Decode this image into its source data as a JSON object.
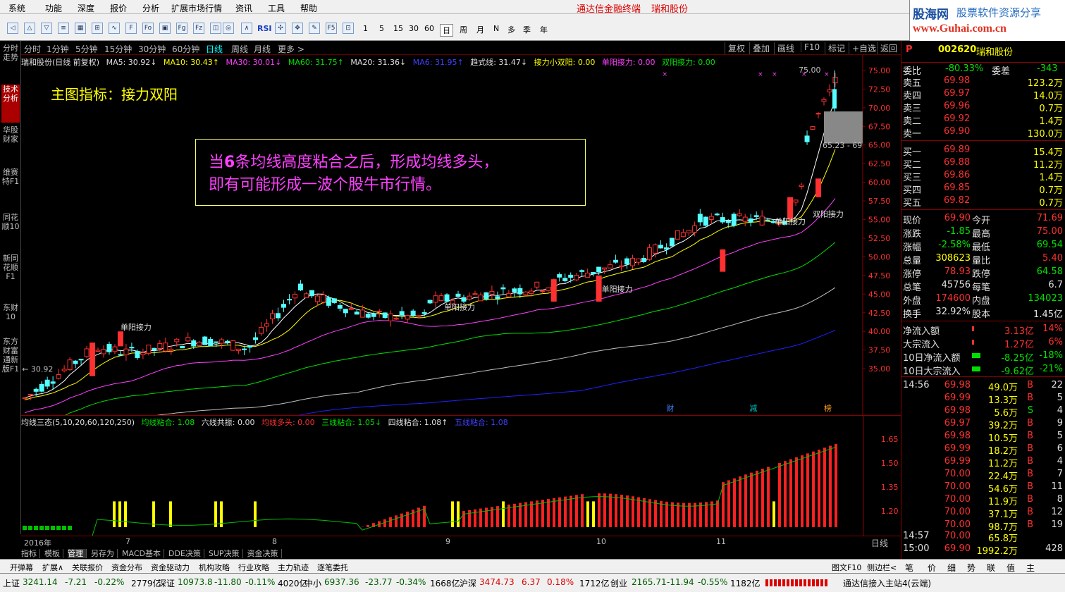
{
  "menu": {
    "items": [
      "系统",
      "功能",
      "深度",
      "报价",
      "分析",
      "扩展市场行情",
      "资讯",
      "工具",
      "帮助"
    ],
    "center_title": "通达信金融终端",
    "stock_title": "瑞和股份"
  },
  "logo": {
    "line1": "股海网",
    "line1b": "股票软件资源分享",
    "line2": "www.Guhai.com.cn"
  },
  "toolbar": {
    "num_buttons": [
      "1",
      "5",
      "15",
      "30",
      "60"
    ],
    "period_buttons": [
      "日",
      "周",
      "月",
      "N",
      "多",
      "季",
      "年"
    ]
  },
  "leftbar": {
    "tabs": [
      "分时走势",
      "技术分析",
      "华股财家",
      "维赛特F1",
      "同花顺10",
      "新同花顺F1",
      "东财10",
      "东方财富通新版F1"
    ]
  },
  "periods": {
    "items": [
      "分时",
      "1分钟",
      "5分钟",
      "15分钟",
      "30分钟",
      "60分钟",
      "日线",
      "周线",
      "月线",
      "更多 >"
    ],
    "right": [
      "复权",
      "叠加",
      "画线",
      "F10",
      "标记",
      "+自选",
      "返回"
    ]
  },
  "legend": {
    "name": "瑞和股份(日线 前复权)",
    "ma5": "MA5: 30.92↓",
    "ma10": "MA10: 30.43↑",
    "ma30": "MA30: 30.01↓",
    "ma60": "MA60: 31.75↑",
    "ma20": "MA20: 31.36↓",
    "ma6": "MA6: 31.95↑",
    "trend": "趋式线: 31.47↓",
    "relay": "接力小双阳: 0.00",
    "single": "单阳接力: 0.00",
    "double": "双阳接力: 0.00"
  },
  "annotation": {
    "title": "主图指标：接力双阳",
    "callout_1a": "当",
    "callout_1b": "6",
    "callout_1c": "条均线高度粘合之后，形成均线多头，",
    "callout_2": "即有可能形成一波个股牛市行情。"
  },
  "price_axis": {
    "labels": [
      "75.00",
      "72.50",
      "70.00",
      "67.50",
      "65.00",
      "62.50",
      "60.00",
      "57.50",
      "55.00",
      "52.50",
      "50.00",
      "47.50",
      "45.00",
      "42.50",
      "40.00",
      "37.50",
      "35.00"
    ]
  },
  "chart_marks": {
    "high": "75.00",
    "range": "65.23 - 69",
    "low": "30.92",
    "labels": [
      "单阳接力",
      "单阳接力",
      "单阳接力",
      "单阳接力",
      "双阳接力"
    ],
    "events": [
      "财",
      "减",
      "榜"
    ]
  },
  "sub_legend": {
    "title": "均线三态(5,10,20,60,120,250)",
    "a": "均线粘合: 1.08",
    "b": "六线共振: 0.00",
    "c": "均线多头: 0.00",
    "d": "三线粘合: 1.05↓",
    "e": "四线粘合: 1.08↑",
    "f": "五线粘合: 1.08"
  },
  "sub_axis": {
    "labels": [
      "1.65",
      "1.50",
      "1.35",
      "1.20"
    ]
  },
  "xaxis": {
    "labels": [
      "2016年",
      "7",
      "8",
      "9",
      "10",
      "11"
    ],
    "right": "日线"
  },
  "bottom_tabs": [
    "指标",
    "模板",
    "管理",
    "另存为",
    "MACD基本",
    "DDE决策",
    "SUP决策",
    "资金决策"
  ],
  "funcbar": [
    "开弹幕",
    "扩展∧",
    "关联报价",
    "资金分布",
    "资金驱动力",
    "机构攻略",
    "行业攻略",
    "主力轨迹",
    "逐笔委托"
  ],
  "funcbar_right": [
    "图文F10",
    "侧边栏<"
  ],
  "quote": {
    "code": "002620",
    "name": "瑞和股份",
    "p": "P",
    "wb_label": "委比",
    "wb": "-80.33%",
    "wc_label": "委差",
    "wc": "-343",
    "asks": [
      [
        "卖五",
        "69.98",
        "123.2万"
      ],
      [
        "卖四",
        "69.97",
        "14.0万"
      ],
      [
        "卖三",
        "69.96",
        "0.7万"
      ],
      [
        "卖二",
        "69.92",
        "1.4万"
      ],
      [
        "卖一",
        "69.90",
        "130.0万"
      ]
    ],
    "bids": [
      [
        "买一",
        "69.89",
        "15.4万"
      ],
      [
        "买二",
        "69.88",
        "11.2万"
      ],
      [
        "买三",
        "69.86",
        "1.4万"
      ],
      [
        "买四",
        "69.85",
        "0.7万"
      ],
      [
        "买五",
        "69.82",
        "0.7万"
      ]
    ],
    "stats": [
      [
        "现价",
        "69.90",
        "今开",
        "71.69"
      ],
      [
        "涨跌",
        "-1.85",
        "最高",
        "75.00"
      ],
      [
        "涨幅",
        "-2.58%",
        "最低",
        "69.54"
      ],
      [
        "总量",
        "308623",
        "量比",
        "5.40"
      ],
      [
        "涨停",
        "78.93",
        "跌停",
        "64.58"
      ],
      [
        "总笔",
        "45756",
        "每笔",
        "6.7"
      ],
      [
        "外盘",
        "174600",
        "内盘",
        "134023"
      ],
      [
        "换手",
        "32.92%",
        "股本",
        "1.45亿"
      ]
    ],
    "flows": [
      [
        "净流入额",
        "3.13亿",
        "14%"
      ],
      [
        "大宗流入",
        "1.27亿",
        "6%"
      ],
      [
        "10日净流入额",
        "-8.25亿",
        "-18%"
      ],
      [
        "10日大宗流入",
        "-9.62亿",
        "-21%"
      ]
    ],
    "ticks": [
      [
        "14:56",
        "69.98",
        "49.0万",
        "B",
        "22"
      ],
      [
        "",
        "69.99",
        "13.3万",
        "B",
        "5"
      ],
      [
        "",
        "69.98",
        "5.6万",
        "S",
        "4"
      ],
      [
        "",
        "69.97",
        "39.2万",
        "B",
        "9"
      ],
      [
        "",
        "69.98",
        "10.5万",
        "B",
        "5"
      ],
      [
        "",
        "69.99",
        "18.2万",
        "B",
        "6"
      ],
      [
        "",
        "69.99",
        "11.2万",
        "B",
        "4"
      ],
      [
        "",
        "70.00",
        "22.4万",
        "B",
        "7"
      ],
      [
        "",
        "70.00",
        "54.6万",
        "B",
        "11"
      ],
      [
        "",
        "70.00",
        "11.9万",
        "B",
        "8"
      ],
      [
        "",
        "70.00",
        "37.1万",
        "B",
        "12"
      ],
      [
        "",
        "70.00",
        "98.7万",
        "B",
        "19"
      ],
      [
        "14:57",
        "70.00",
        "65.8万",
        "",
        ""
      ],
      [
        "15:00",
        "69.90",
        "1992.2万",
        "",
        "428"
      ]
    ]
  },
  "rtabs": [
    "笔",
    "价",
    "细",
    "势",
    "联",
    "值",
    "主"
  ],
  "status": {
    "sh_label": "上证",
    "sh": "3241.14",
    "sh_chg": "-7.21",
    "sh_pct": "-0.22%",
    "sh_amt": "2779亿",
    "sz_label": "深证",
    "sz": "10973.8",
    "sz_chg": "-11.80",
    "sz_pct": "-0.11%",
    "sz_amt": "4020亿",
    "zx_label": "中小",
    "zx": "6937.36",
    "zx_chg": "-23.77",
    "zx_pct": "-0.34%",
    "zx_amt": "1668亿",
    "hs_label": "沪深",
    "hs": "3474.73",
    "hs_chg": "6.37",
    "hs_pct": "0.18%",
    "hs_amt": "1712亿",
    "cy_label": "创业",
    "cy": "2165.71",
    "cy_chg": "-11.94",
    "cy_pct": "-0.55%",
    "cy_amt": "1182亿",
    "conn": "通达信接入主站4(云端)"
  },
  "colors": {
    "up": "#ff3030",
    "down": "#54ffff",
    "ma5": "#ffffff",
    "ma10": "#ffff00",
    "ma20": "#ff40ff",
    "ma60": "#00e000",
    "ma120": "#c0c0c0",
    "ma250": "#2020ff"
  }
}
